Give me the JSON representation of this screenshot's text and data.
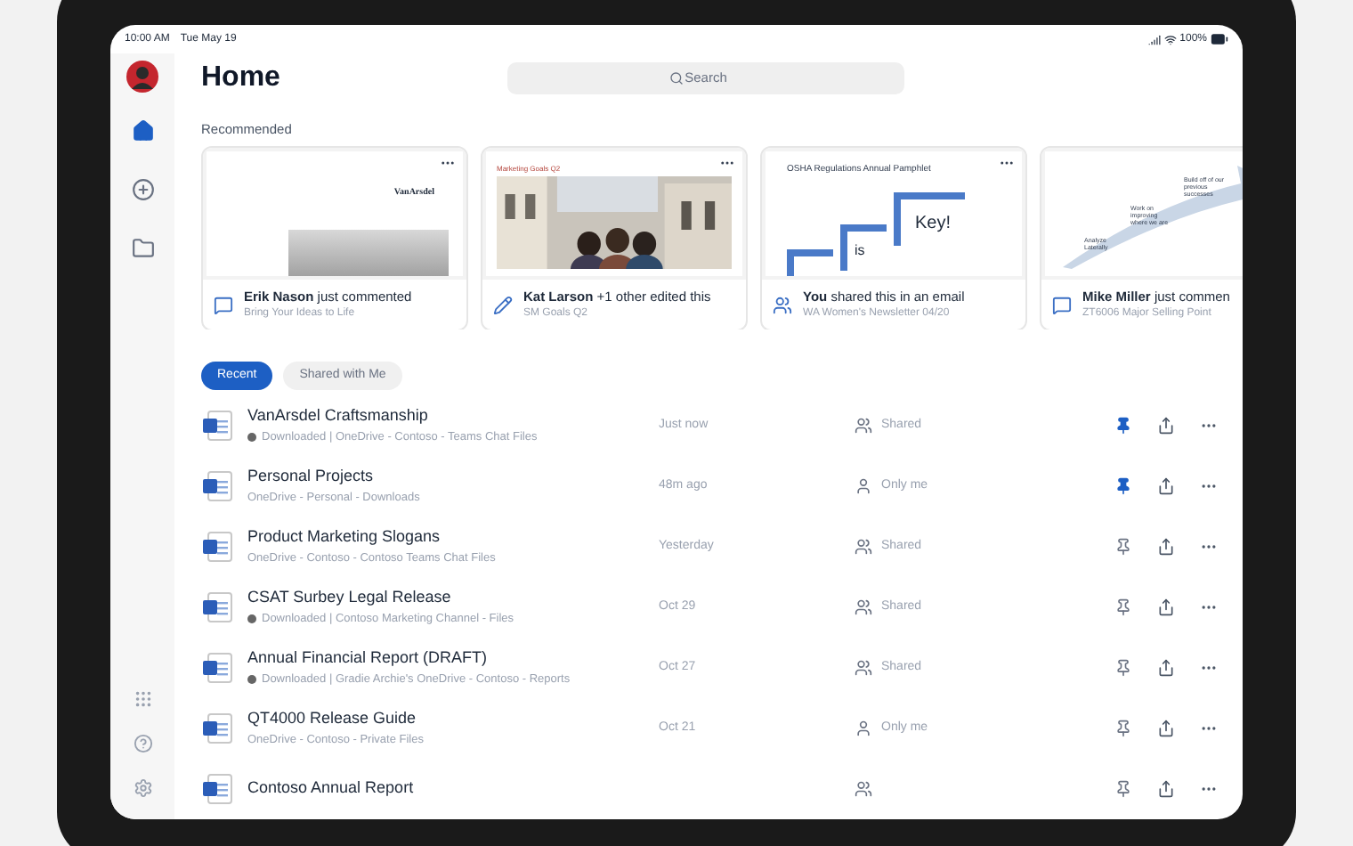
{
  "status_bar": {
    "time": "10:00 AM",
    "date": "Tue May 19",
    "battery": "100%"
  },
  "sidebar": {
    "items": [
      {
        "kind": "home",
        "selected": true
      },
      {
        "kind": "new",
        "selected": false
      },
      {
        "kind": "files",
        "selected": false
      }
    ],
    "bottom": [
      {
        "kind": "apps"
      },
      {
        "kind": "help"
      },
      {
        "kind": "settings"
      }
    ]
  },
  "header": {
    "title": "Home",
    "search": {
      "placeholder": "Search"
    }
  },
  "recommended": {
    "label": "Recommended",
    "cards": [
      {
        "thumbnail": {
          "kind": "document",
          "texts": [
            "VanArsdel"
          ]
        },
        "kind": "comment",
        "text": "**Erik Nason** just commented",
        "subtitle": "Bring Your Ideas to Life"
      },
      {
        "thumbnail": {
          "texts": [
            "Marketing Goals Q2"
          ]
        },
        "kind": "edit",
        "text": "**Kat Larson** +1 other edited this",
        "subtitle": "SM Goals Q2"
      },
      {
        "thumbnail": {
          "kind": "steps",
          "texts": [
            "OSHA Regulations Annual Pamphlet",
            "is",
            "Key!"
          ]
        },
        "kind": "share",
        "text": "**You** shared this in an email",
        "subtitle": "WA Women's Newsletter 04/20"
      },
      {
        "thumbnail": {
          "kind": "arrow",
          "texts": [
            "Build off of our previous successes",
            "Work on improving where we are",
            "Analyze Laterally"
          ]
        },
        "kind": "comment",
        "text": "**Mike Miller** just commen",
        "subtitle": "ZT6006 Major Selling Point"
      }
    ]
  },
  "tabs": [
    {
      "label": "Recent",
      "selected": true
    },
    {
      "label": "Shared with Me",
      "selected": false
    }
  ],
  "files": [
    {
      "title": "VanArsdel Craftsmanship",
      "downloaded": true,
      "location": "Downloaded | OneDrive - Contoso - Teams Chat Files",
      "time": "Just now",
      "kind": "shared",
      "sharing_label": "Shared",
      "pinned": true
    },
    {
      "title": "Personal Projects",
      "downloaded": false,
      "location": "OneDrive - Personal - Downloads",
      "time": "48m ago",
      "kind": "private",
      "sharing_label": "Only me",
      "pinned": true
    },
    {
      "title": "Product Marketing Slogans",
      "downloaded": false,
      "location": "OneDrive - Contoso - Contoso Teams Chat Files",
      "time": "Yesterday",
      "kind": "shared",
      "sharing_label": "Shared",
      "pinned": false
    },
    {
      "title": "CSAT Surbey Legal Release",
      "downloaded": true,
      "location": "Downloaded | Contoso Marketing Channel - Files",
      "time": "Oct 29",
      "kind": "shared",
      "sharing_label": "Shared",
      "pinned": false
    },
    {
      "title": "Annual Financial Report (DRAFT)",
      "downloaded": true,
      "location": "Downloaded | Gradie Archie's OneDrive - Contoso - Reports",
      "time": "Oct 27",
      "kind": "shared",
      "sharing_label": "Shared",
      "pinned": false
    },
    {
      "title": "QT4000 Release Guide",
      "downloaded": false,
      "location": "OneDrive - Contoso - Private Files",
      "time": "Oct 21",
      "kind": "private",
      "sharing_label": "Only me",
      "pinned": false
    },
    {
      "title": "Contoso Annual Report",
      "kind": "shared",
      "pinned": false
    }
  ]
}
